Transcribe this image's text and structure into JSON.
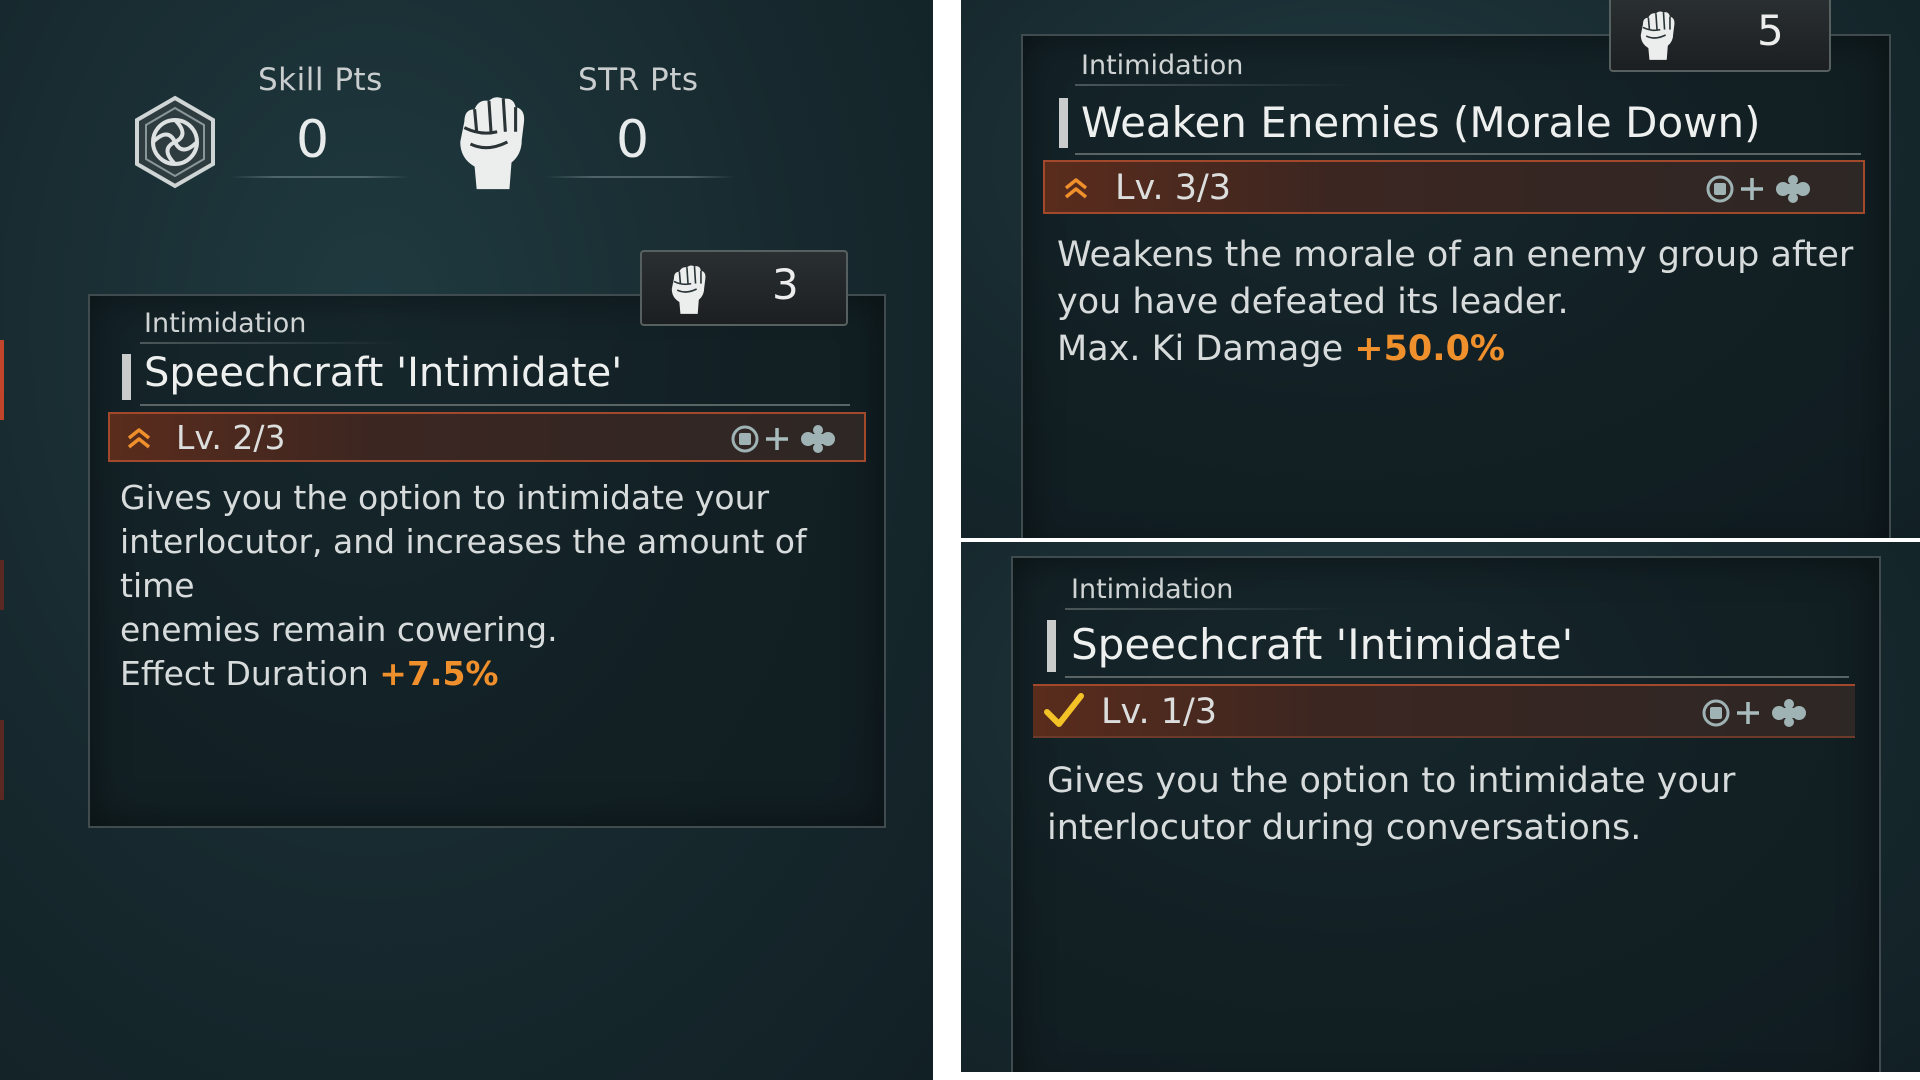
{
  "colors": {
    "background": "#17292e",
    "accent_orange": "#f0902c",
    "level_bar_border": "#a2482b",
    "checkmark": "#f2c227"
  },
  "points": {
    "skill_icon": "hexagon-swirl-icon",
    "skill_label": "Skill Pts",
    "skill_value": "0",
    "str_icon": "raised-fist-icon",
    "str_label": "STR Pts",
    "str_value": "0"
  },
  "cards": [
    {
      "cost_icon": "raised-fist-icon",
      "cost": "3",
      "category": "Intimidation",
      "title": "Speechcraft 'Intimidate'",
      "level_icon": "chevron-up-double-icon",
      "level": "Lv. 2/3",
      "level_progress": 0.667,
      "input_hint_icon": "square-button-plus-dpad-icon",
      "desc_lines": [
        "Gives you the option to intimidate your",
        "interlocutor, and increases the amount of time",
        "enemies remain cowering."
      ],
      "stat_label": "Effect Duration",
      "stat_value": "+7.5%"
    },
    {
      "cost_icon": "raised-fist-icon",
      "cost": "5",
      "category": "Intimidation",
      "title": "Weaken Enemies (Morale Down)",
      "level_icon": "chevron-up-double-icon",
      "level": "Lv. 3/3",
      "level_progress": 1.0,
      "input_hint_icon": "square-button-plus-dpad-icon",
      "desc_lines": [
        "Weakens the morale of an enemy group after",
        "you have defeated its leader."
      ],
      "stat_label": "Max. Ki Damage",
      "stat_value": "+50.0%"
    },
    {
      "category": "Intimidation",
      "title": "Speechcraft 'Intimidate'",
      "level_icon": "checkmark-icon",
      "level": "Lv. 1/3",
      "level_progress": 0.333,
      "input_hint_icon": "square-button-plus-dpad-icon",
      "desc_lines": [
        "Gives you the option to intimidate your",
        "interlocutor during conversations."
      ]
    }
  ]
}
